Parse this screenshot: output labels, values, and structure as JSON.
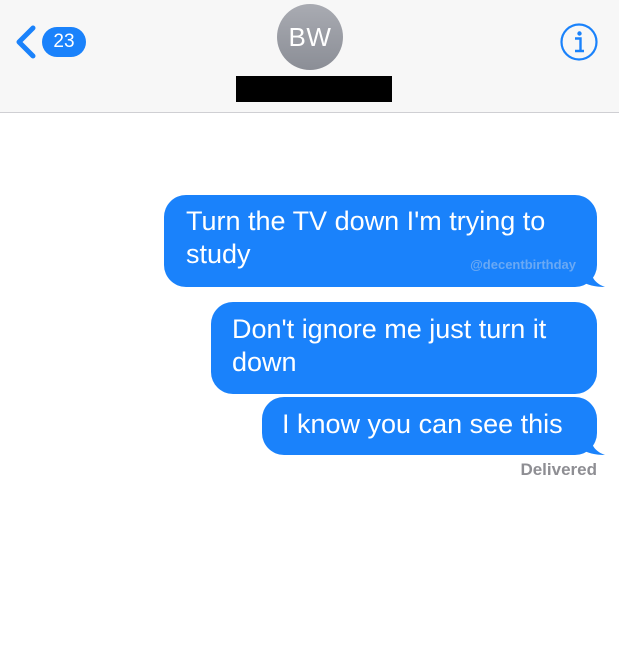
{
  "header": {
    "back_badge_count": "23",
    "contact_initials": "BW"
  },
  "messages": [
    {
      "text": "Turn the TV down I'm trying to study",
      "watermark": "@decentbirthday"
    },
    {
      "text": "Don't ignore me just turn it down"
    },
    {
      "text": "I know you can see this"
    }
  ],
  "status": "Delivered",
  "colors": {
    "bubble": "#1a82fb",
    "accent": "#1a82fb",
    "header_bg": "#f7f7f7",
    "status_text": "#8e8e93"
  },
  "icons": {
    "back": "chevron-left-icon",
    "info": "info-icon"
  }
}
